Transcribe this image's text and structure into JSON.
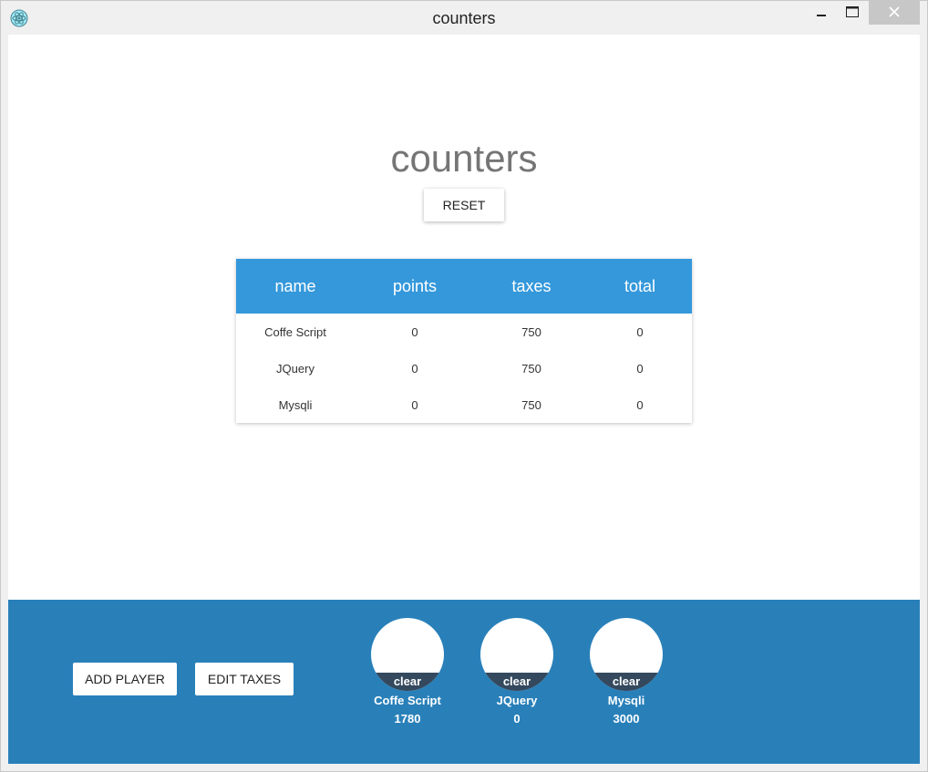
{
  "window": {
    "title": "counters",
    "minimize_icon": "minimize-icon",
    "maximize_icon": "maximize-icon",
    "close_icon": "close-icon",
    "app_icon": "electron-atom-icon"
  },
  "main": {
    "heading": "counters",
    "reset_label": "RESET"
  },
  "table": {
    "headers": [
      "name",
      "points",
      "taxes",
      "total"
    ],
    "rows": [
      [
        "Coffe Script",
        "0",
        "750",
        "0"
      ],
      [
        "JQuery",
        "0",
        "750",
        "0"
      ],
      [
        "Mysqli",
        "0",
        "750",
        "0"
      ]
    ],
    "header_color": "#3498db"
  },
  "footer": {
    "background_color": "#2980b9",
    "add_player_label": "ADD PLAYER",
    "edit_taxes_label": "EDIT TAXES",
    "players": [
      {
        "clear_label": "clear",
        "name": "Coffe Script",
        "score": "1780"
      },
      {
        "clear_label": "clear",
        "name": "JQuery",
        "score": "0"
      },
      {
        "clear_label": "clear",
        "name": "Mysqli",
        "score": "3000"
      }
    ]
  }
}
